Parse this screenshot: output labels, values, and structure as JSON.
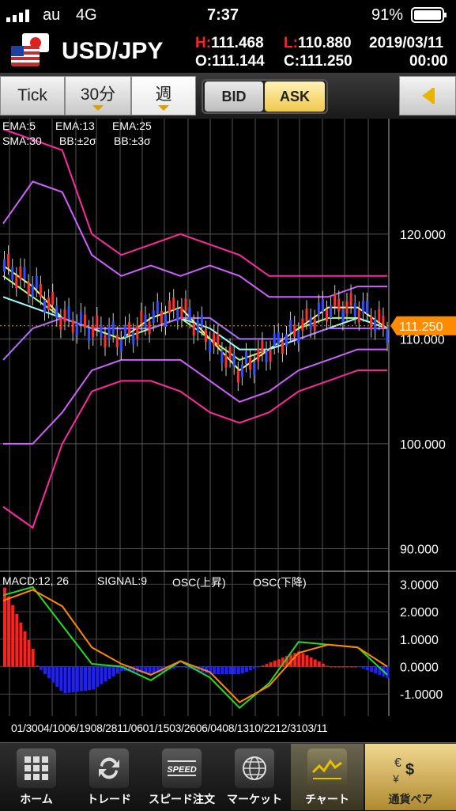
{
  "status_bar": {
    "carrier": "au",
    "network": "4G",
    "time": "7:37",
    "battery": "91%"
  },
  "header": {
    "pair": "USD/JPY",
    "high_label": "H:",
    "high": "111.468",
    "low_label": "L:",
    "low": "110.880",
    "open_label": "O:",
    "open": "111.144",
    "close_label": "C:",
    "close": "111.250",
    "date": "2019/03/11",
    "time": "00:00"
  },
  "toolbar": {
    "tabs": [
      "Tick",
      "30分",
      "週"
    ],
    "selected_tab": "週",
    "bid_label": "BID",
    "ask_label": "ASK",
    "selected_side": "ASK"
  },
  "indicators": {
    "ema5": "EMA:5",
    "ema13": "EMA:13",
    "ema25": "EMA:25",
    "sma30": "SMA:30",
    "bb2": "BB:±2σ",
    "bb3": "BB:±3σ",
    "colors": {
      "ema5": "#ffff66",
      "ema13": "#b0ff80",
      "ema25": "#a0ffff",
      "sma30": "#b070ff",
      "bb2": "#d060ff",
      "bb3": "#ff2aa0"
    }
  },
  "macd_legend": {
    "macd": "MACD:12, 26",
    "signal": "SIGNAL:9",
    "osc_up": "OSC(上昇)",
    "osc_down": "OSC(下降)",
    "colors": {
      "macd": "#22dd22",
      "signal": "#ff8800",
      "osc_up": "#ff2020",
      "osc_down": "#2020ff"
    }
  },
  "chart_data": [
    {
      "type": "line",
      "title": "",
      "yticks": [
        "120.000",
        "110.000",
        "100.000",
        "90.000"
      ],
      "ylim": [
        88,
        131
      ],
      "current_price": "111.250",
      "x": [
        "01/30",
        "04/10",
        "06/19",
        "08/28",
        "11/06",
        "01/15",
        "03/26",
        "06/04",
        "08/13",
        "10/22",
        "12/31",
        "03/11"
      ],
      "series": [
        {
          "name": "EMA:5",
          "values": [
            117,
            115,
            112,
            111,
            110,
            112,
            113,
            110,
            107,
            109,
            111,
            113,
            113,
            111
          ]
        },
        {
          "name": "EMA:13",
          "values": [
            116,
            114,
            112,
            111,
            110,
            111,
            112,
            110,
            108,
            109,
            111,
            112,
            112,
            111
          ]
        },
        {
          "name": "EMA:25",
          "values": [
            114,
            113,
            112,
            111,
            111,
            111,
            112,
            111,
            109,
            109,
            110,
            111,
            112,
            111
          ]
        },
        {
          "name": "SMA:30",
          "values": [
            108,
            111,
            112,
            111,
            111,
            111,
            112,
            112,
            110,
            110,
            110,
            111,
            111,
            111
          ]
        },
        {
          "name": "BB:+2σ",
          "values": [
            121,
            125,
            124,
            118,
            116,
            117,
            116,
            117,
            116,
            114,
            114,
            114,
            115,
            115
          ]
        },
        {
          "name": "BB:-2σ",
          "values": [
            100,
            100,
            103,
            107,
            108,
            108,
            108,
            106,
            104,
            105,
            107,
            108,
            109,
            109
          ]
        },
        {
          "name": "BB:+3σ",
          "values": [
            130,
            129,
            128,
            120,
            118,
            119,
            120,
            119,
            118,
            116,
            116,
            116,
            116,
            116
          ]
        },
        {
          "name": "BB:-3σ",
          "values": [
            94,
            92,
            100,
            105,
            106,
            106,
            105,
            103,
            102,
            103,
            105,
            106,
            107,
            107
          ]
        }
      ]
    },
    {
      "type": "line",
      "title": "",
      "yticks": [
        "3.0000",
        "2.0000",
        "1.0000",
        "0.0000",
        "-1.0000"
      ],
      "ylim": [
        -1.8,
        3.3
      ],
      "series": [
        {
          "name": "MACD:12, 26",
          "values": [
            2.6,
            2.9,
            1.5,
            0.1,
            0.0,
            -0.5,
            0.2,
            -0.4,
            -1.5,
            -0.6,
            0.9,
            0.8,
            0.7,
            -0.3
          ]
        },
        {
          "name": "SIGNAL:9",
          "values": [
            2.4,
            2.8,
            2.2,
            0.7,
            0.1,
            -0.3,
            0.2,
            -0.2,
            -1.3,
            -0.7,
            0.5,
            0.8,
            0.7,
            0.0
          ]
        }
      ]
    }
  ],
  "xaxis_labels": "01/3004/1006/1908/2811/0601/1503/2606/0408/1310/2212/3103/11",
  "tabbar": [
    {
      "label": "ホーム",
      "icon": "home-grid-icon"
    },
    {
      "label": "トレード",
      "icon": "trade-arrows-icon"
    },
    {
      "label": "スピード注文",
      "icon": "speed-icon"
    },
    {
      "label": "マーケット",
      "icon": "globe-icon"
    },
    {
      "label": "チャート",
      "icon": "chart-icon"
    },
    {
      "label": "通貨ペア",
      "icon": "currency-icon"
    }
  ],
  "tabbar_selected": "チャート"
}
